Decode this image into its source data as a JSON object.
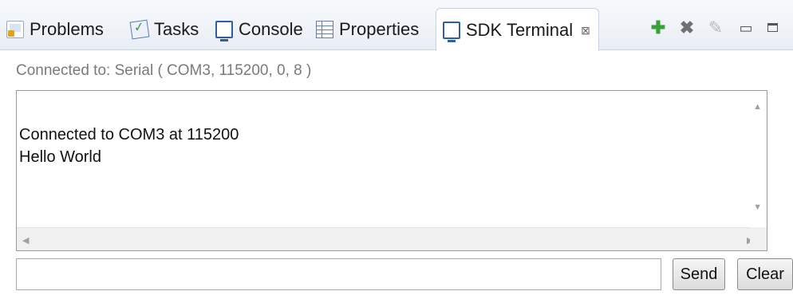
{
  "tabs": [
    {
      "label": "Problems",
      "icon": "problems-icon"
    },
    {
      "label": "Tasks",
      "icon": "tasks-icon"
    },
    {
      "label": "Console",
      "icon": "console-icon"
    },
    {
      "label": "Properties",
      "icon": "properties-icon"
    },
    {
      "label": "SDK Terminal",
      "icon": "terminal-icon",
      "active": true,
      "close_glyph": "⊠"
    }
  ],
  "toolbar": {
    "add_glyph": "✚",
    "remove_glyph": "✖",
    "clear_glyph": "✎",
    "minimize_glyph": "▭"
  },
  "status": "Connected to: Serial (  COM3, 115200, 0, 8 )",
  "terminal": {
    "lines": [
      "Connected to COM3 at 115200",
      "Hello World"
    ]
  },
  "input": {
    "value": "",
    "placeholder": ""
  },
  "buttons": {
    "send": "Send",
    "clear": "Clear"
  },
  "colors": {
    "accent_green": "#3aa13a",
    "tab_border": "#c9d2de"
  }
}
